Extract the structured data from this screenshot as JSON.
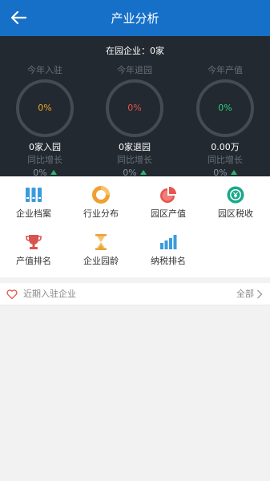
{
  "header": {
    "title": "产业分析"
  },
  "park": {
    "summary": "在园企业：0家"
  },
  "stats": [
    {
      "caption": "今年入驻",
      "ring_value": "0%",
      "ring_color": "#f5a623",
      "value": "0家入园",
      "yoy_label": "同比增长",
      "yoy_value": "0%"
    },
    {
      "caption": "今年退园",
      "ring_value": "0%",
      "ring_color": "#e8544e",
      "value": "0家退园",
      "yoy_label": "同比增长",
      "yoy_value": "0%"
    },
    {
      "caption": "今年产值",
      "ring_value": "0%",
      "ring_color": "#2bd07a",
      "value": "0.00万",
      "yoy_label": "同比增长",
      "yoy_value": "0%"
    }
  ],
  "menu": [
    {
      "label": "企业档案",
      "icon": "binders-icon"
    },
    {
      "label": "行业分布",
      "icon": "donut-icon"
    },
    {
      "label": "园区产值",
      "icon": "pie-icon"
    },
    {
      "label": "园区税收",
      "icon": "yen-coin-icon"
    },
    {
      "label": "产值排名",
      "icon": "trophy-icon"
    },
    {
      "label": "企业园龄",
      "icon": "hourglass-icon"
    },
    {
      "label": "纳税排名",
      "icon": "bar-chart-icon"
    }
  ],
  "recent": {
    "title": "近期入驻企业",
    "more_label": "全部"
  },
  "colors": {
    "primary": "#1670c8",
    "panel": "#222930",
    "up_arrow": "#2bb673",
    "accent": "#e8544e"
  }
}
